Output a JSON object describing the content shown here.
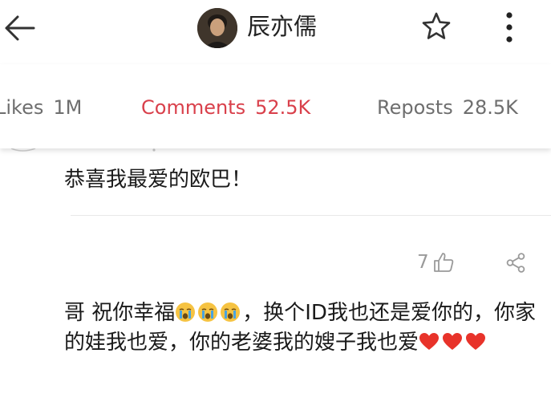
{
  "header": {
    "username": "辰亦儒",
    "icons": {
      "back": "back-arrow-icon",
      "star": "star-icon",
      "more": "more-vertical-icon"
    }
  },
  "tabs": [
    {
      "label": "Likes",
      "count": "1M",
      "active": false
    },
    {
      "label": "Comments",
      "count": "52.5K",
      "active": true
    },
    {
      "label": "Reposts",
      "count": "28.5K",
      "active": false
    }
  ],
  "comments": [
    {
      "text": "恭喜我最爱的欧巴！"
    },
    {
      "like_count": "7",
      "text_part1": "哥 祝你幸福",
      "emoji": [
        "crying-face-emoji",
        "crying-face-emoji",
        "crying-face-emoji"
      ],
      "text_part2": "，换个ID我也还是爱你的，你家的娃我也爱，你的老婆我的嫂子我也爱",
      "hearts": [
        "red-heart-emoji",
        "red-heart-emoji",
        "red-heart-emoji"
      ]
    }
  ],
  "colors": {
    "active_tab": "#d9404b",
    "inactive_tab": "#6e6e6e",
    "heart": "#e8332a",
    "emoji_face": "#f6c342",
    "tears": "#4aa3df"
  }
}
